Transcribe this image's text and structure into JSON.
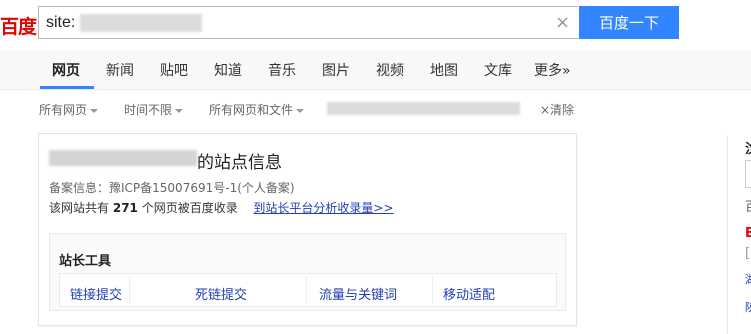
{
  "header": {
    "logo_text": "百度",
    "search_value": "site:",
    "clear_symbol": "×",
    "search_button": "百度一下"
  },
  "tabs": [
    {
      "label": "网页",
      "active": true
    },
    {
      "label": "新闻"
    },
    {
      "label": "贴吧"
    },
    {
      "label": "知道"
    },
    {
      "label": "音乐"
    },
    {
      "label": "图片"
    },
    {
      "label": "视频"
    },
    {
      "label": "地图"
    },
    {
      "label": "文库"
    },
    {
      "label": "更多»"
    }
  ],
  "filters": {
    "items": [
      "所有网页",
      "时间不限",
      "所有网页和文件"
    ],
    "clear_label": "×清除"
  },
  "site_card": {
    "title_suffix": "的站点信息",
    "record_info": "备案信息：豫ICP备15007691号-1(个人备案)",
    "count_prefix": "该网站共有",
    "count_value": "271",
    "count_suffix": "个网页被百度收录",
    "analysis_link": "到站长平台分析收录量>>",
    "tools_title": "站长工具",
    "tools": [
      "链接提交",
      "死链提交",
      "流量与关键词",
      "移动适配"
    ]
  },
  "right_fragments": [
    "汶",
    "百",
    "E",
    "[",
    "湖",
    "陕"
  ],
  "colors": {
    "brand_red": "#e10602",
    "button_blue": "#3385ff",
    "link_blue": "#2440b3"
  }
}
